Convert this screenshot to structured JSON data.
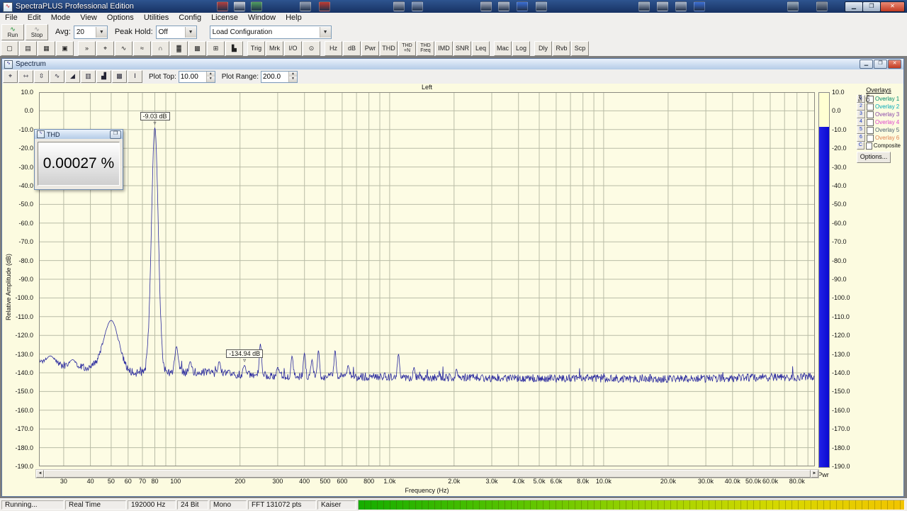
{
  "taskbar": {
    "icons": [
      {
        "x": 306,
        "color": "#b34040"
      },
      {
        "x": 330,
        "color": "#cfd6e2"
      },
      {
        "x": 354,
        "color": "#4f9f5f"
      },
      {
        "x": 423,
        "color": "#97a3b8"
      },
      {
        "x": 450,
        "color": "#c03a32"
      },
      {
        "x": 555,
        "color": "#a3adc0"
      },
      {
        "x": 581,
        "color": "#8fa3c4"
      },
      {
        "x": 678,
        "color": "#a6aec0"
      },
      {
        "x": 703,
        "color": "#b3bccb"
      },
      {
        "x": 729,
        "color": "#3a6fd8"
      },
      {
        "x": 756,
        "color": "#9cafc8"
      },
      {
        "x": 901,
        "color": "#a7b3c3"
      },
      {
        "x": 927,
        "color": "#b6c0d0"
      },
      {
        "x": 953,
        "color": "#aab8cc"
      },
      {
        "x": 979,
        "color": "#3a6fd8"
      },
      {
        "x": 1111,
        "color": "#9fb0c0"
      },
      {
        "x": 1152,
        "color": "#87919f"
      }
    ]
  },
  "window": {
    "title": "SpectraPLUS Professional Edition",
    "minimize_glyph": "▁",
    "maximize_glyph": "❐",
    "close_glyph": "✕"
  },
  "menu": {
    "items": [
      "File",
      "Edit",
      "Mode",
      "View",
      "Options",
      "Utilities",
      "Config",
      "License",
      "Window",
      "Help"
    ]
  },
  "transport": {
    "run_label": "Run",
    "stop_label": "Stop",
    "avg_label": "Avg:",
    "avg_value": "20",
    "peak_hold_label": "Peak Hold:",
    "peak_hold_value": "Off",
    "config_value": "Load Configuration",
    "combo_arrow": "▼"
  },
  "toolbar2": {
    "buttons": [
      {
        "name": "new-file-button",
        "glyph": "▢"
      },
      {
        "name": "open-file-button",
        "glyph": "▤"
      },
      {
        "name": "save-file-button",
        "glyph": "▦"
      },
      {
        "name": "print-button",
        "glyph": "▣"
      },
      {
        "name": "separator"
      },
      {
        "name": "fast-run-button",
        "glyph": "»"
      },
      {
        "name": "zoom-tool-button",
        "glyph": "⌖"
      },
      {
        "name": "time-series-view-button",
        "glyph": "∿"
      },
      {
        "name": "dual-waveform-view-button",
        "glyph": "≈"
      },
      {
        "name": "spectrum-view-button",
        "glyph": "∩"
      },
      {
        "name": "spectrogram-view-button",
        "glyph": "▓"
      },
      {
        "name": "surface-view-button",
        "glyph": "▩"
      },
      {
        "name": "table-view-button",
        "glyph": "⊞"
      },
      {
        "name": "decay-view-button",
        "glyph": "▙"
      },
      {
        "name": "separator"
      },
      {
        "name": "trigger-button",
        "label": "Trig"
      },
      {
        "name": "marker-button",
        "label": "Mrk"
      },
      {
        "name": "io-button",
        "label": "I/O"
      },
      {
        "name": "timer-button",
        "glyph": "⊙"
      },
      {
        "name": "separator"
      },
      {
        "name": "hz-button",
        "label": "Hz"
      },
      {
        "name": "db-button",
        "label": "dB"
      },
      {
        "name": "pwr-button",
        "label": "Pwr"
      },
      {
        "name": "thd-button",
        "label": "THD"
      },
      {
        "name": "thd-n-button",
        "lines": [
          "THD",
          "+N"
        ]
      },
      {
        "name": "thd-freq-button",
        "lines": [
          "THD",
          "Freq"
        ]
      },
      {
        "name": "imd-button",
        "label": "IMD"
      },
      {
        "name": "snr-button",
        "label": "SNR"
      },
      {
        "name": "leq-button",
        "label": "Leq"
      },
      {
        "name": "separator"
      },
      {
        "name": "macro-button",
        "label": "Mac"
      },
      {
        "name": "log-button",
        "label": "Log"
      },
      {
        "name": "separator"
      },
      {
        "name": "delay-button",
        "label": "Dly"
      },
      {
        "name": "reverb-button",
        "label": "Rvb"
      },
      {
        "name": "scope-button",
        "label": "Scp"
      }
    ]
  },
  "spectrum_window": {
    "title": "Spectrum",
    "minimize_glyph": "▁",
    "maximize_glyph": "❐",
    "close_glyph": "✕",
    "tools": [
      {
        "name": "zoom-button",
        "glyph": "⌖"
      },
      {
        "name": "zoom-x-in-button",
        "glyph": "⇿"
      },
      {
        "name": "zoom-x-out-button",
        "glyph": "⇳"
      },
      {
        "name": "line-plot-button",
        "glyph": "∿"
      },
      {
        "name": "area-plot-button",
        "glyph": "◢"
      },
      {
        "name": "bar-plot-button",
        "glyph": "▥"
      },
      {
        "name": "histogram-button",
        "glyph": "▟"
      },
      {
        "name": "spectrogram-button",
        "glyph": "▩"
      },
      {
        "name": "marker-mode-button",
        "glyph": "Ⅰ"
      }
    ],
    "plot_top_label": "Plot Top:",
    "plot_top_value": "10.00",
    "plot_range_label": "Plot Range:",
    "plot_range_value": "200.0"
  },
  "thd_window": {
    "title": "THD",
    "button_glyph": "❐",
    "value": "0.00027 %"
  },
  "chart_data": {
    "type": "line",
    "title": "Left",
    "xlabel": "Frequency (Hz)",
    "ylabel": "Relative Amplitude (dB)",
    "x_scale": "log",
    "x_range_hz": [
      23,
      97000
    ],
    "y_range_db": [
      -190,
      10
    ],
    "y_tick_step_db": 10,
    "grid_on": true,
    "grid_color": "#b9bca6",
    "trace_color": "#2a2a9e",
    "plot_bg": "#fdfce4",
    "x_ticks": [
      {
        "f": 30,
        "label": "30"
      },
      {
        "f": 40,
        "label": "40"
      },
      {
        "f": 50,
        "label": "50"
      },
      {
        "f": 60,
        "label": "60"
      },
      {
        "f": 70,
        "label": "70"
      },
      {
        "f": 80,
        "label": "80"
      },
      {
        "f": 100,
        "label": "100"
      },
      {
        "f": 200,
        "label": "200"
      },
      {
        "f": 300,
        "label": "300"
      },
      {
        "f": 400,
        "label": "400"
      },
      {
        "f": 500,
        "label": "500"
      },
      {
        "f": 600,
        "label": "600"
      },
      {
        "f": 800,
        "label": "800"
      },
      {
        "f": 1000,
        "label": "1.0k"
      },
      {
        "f": 2000,
        "label": "2.0k"
      },
      {
        "f": 3000,
        "label": "3.0k"
      },
      {
        "f": 4000,
        "label": "4.0k"
      },
      {
        "f": 5000,
        "label": "5.0k"
      },
      {
        "f": 6000,
        "label": "6.0k"
      },
      {
        "f": 8000,
        "label": "8.0k"
      },
      {
        "f": 10000,
        "label": "10.0k"
      },
      {
        "f": 20000,
        "label": "20.0k"
      },
      {
        "f": 30000,
        "label": "30.0k"
      },
      {
        "f": 40000,
        "label": "40.0k"
      },
      {
        "f": 50000,
        "label": "50.0k"
      },
      {
        "f": 60000,
        "label": "60.0k"
      },
      {
        "f": 80000,
        "label": "80.0k"
      }
    ],
    "x_gridlines_extra": [
      90,
      700,
      900,
      7000,
      9000,
      70000,
      90000
    ],
    "noise_floor": [
      [
        23,
        -134
      ],
      [
        30,
        -136
      ],
      [
        40,
        -137
      ],
      [
        60,
        -140
      ],
      [
        90,
        -140
      ],
      [
        130,
        -139.5
      ],
      [
        200,
        -141
      ],
      [
        400,
        -142
      ],
      [
        800,
        -142
      ],
      [
        2000,
        -142.5
      ],
      [
        8000,
        -143
      ],
      [
        30000,
        -143
      ],
      [
        97000,
        -142
      ]
    ],
    "noise_jitter_db": 2.2,
    "peaks": [
      {
        "f": 26,
        "db": -131,
        "w": 0.02
      },
      {
        "f": 33,
        "db": -133,
        "w": 0.015
      },
      {
        "f": 50,
        "db": -112,
        "w": 0.035
      },
      {
        "f": 80,
        "db": -9.03,
        "w": 0.016
      },
      {
        "f": 101,
        "db": -126,
        "w": 0.008
      },
      {
        "f": 117,
        "db": -134,
        "w": 0.006
      },
      {
        "f": 160,
        "db": -134,
        "w": 0.006
      },
      {
        "f": 210,
        "db": -136,
        "w": 0.006
      },
      {
        "f": 249,
        "db": -124.5,
        "w": 0.005
      },
      {
        "f": 300,
        "db": -137,
        "w": 0.005
      },
      {
        "f": 350,
        "db": -131,
        "w": 0.005
      },
      {
        "f": 400,
        "db": -129.5,
        "w": 0.005
      },
      {
        "f": 434,
        "db": -133,
        "w": 0.005
      },
      {
        "f": 465,
        "db": -128,
        "w": 0.005
      },
      {
        "f": 556,
        "db": -128,
        "w": 0.005
      },
      {
        "f": 640,
        "db": -136,
        "w": 0.005
      },
      {
        "f": 1100,
        "db": -130,
        "w": 0.005
      },
      {
        "f": 1300,
        "db": -137,
        "w": 0.004
      },
      {
        "f": 2050,
        "db": -138,
        "w": 0.004
      }
    ],
    "markers": [
      {
        "f": 80,
        "point_db": -9.03,
        "label": "-9.03 dB"
      },
      {
        "f": 210,
        "point_db": -136,
        "label": "-134.94 dB"
      }
    ],
    "power_bar": {
      "top_db": -8,
      "label": "Pwr"
    }
  },
  "overlays": {
    "title": "Overlays",
    "col_set": "Set",
    "col_chn": "Chn",
    "rows": [
      {
        "btn": "1",
        "label": "Overlay 1",
        "color": "#008a6a"
      },
      {
        "btn": "2",
        "label": "Overlay 2",
        "color": "#00aab8"
      },
      {
        "btn": "3",
        "label": "Overlay 3",
        "color": "#8a46aa"
      },
      {
        "btn": "4",
        "label": "Overlay 4",
        "color": "#e044ca"
      },
      {
        "btn": "5",
        "label": "Overlay 5",
        "color": "#4a6070"
      },
      {
        "btn": "6",
        "label": "Overlay 6",
        "color": "#e08050"
      },
      {
        "btn": "C",
        "label": "Composite",
        "color": "#111111"
      }
    ],
    "options_label": "Options..."
  },
  "status_bar": {
    "fields": [
      {
        "text": "Running...",
        "w": 88
      },
      {
        "text": "Real Time",
        "w": 86
      },
      {
        "text": "192000 Hz",
        "w": 68
      },
      {
        "text": "24 Bit",
        "w": 44
      },
      {
        "text": "Mono",
        "w": 52
      },
      {
        "text": "FFT 131072 pts",
        "w": 96
      },
      {
        "text": "Kaiser",
        "w": 54
      }
    ]
  }
}
